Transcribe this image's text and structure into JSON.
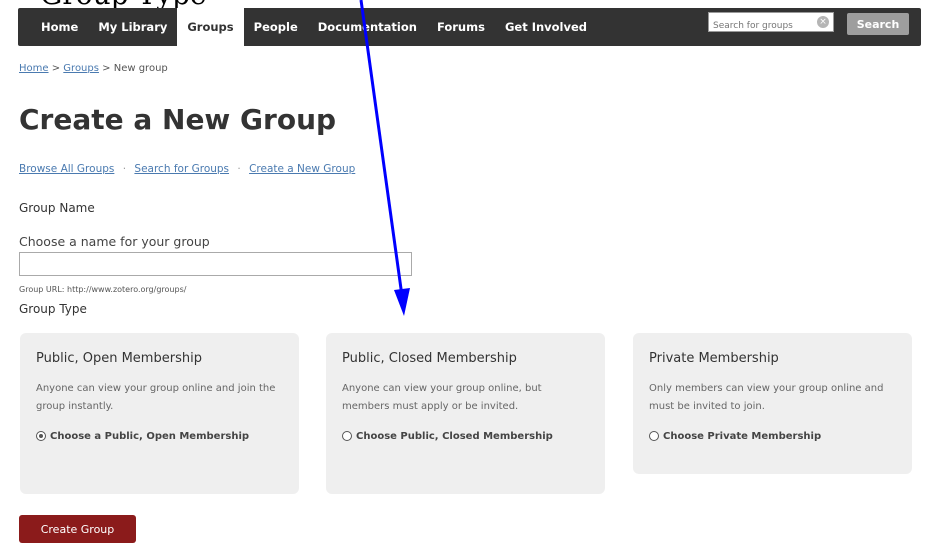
{
  "caption": "Group Type",
  "nav": {
    "items": [
      {
        "label": "Home"
      },
      {
        "label": "My Library"
      },
      {
        "label": "Groups"
      },
      {
        "label": "People"
      },
      {
        "label": "Documentation"
      },
      {
        "label": "Forums"
      },
      {
        "label": "Get Involved"
      }
    ],
    "active_item": "Groups",
    "search_placeholder": "Search for groups",
    "search_button": "Search"
  },
  "breadcrumb": {
    "home": "Home",
    "sep1": ">",
    "groups": "Groups",
    "sep2": ">",
    "current": "New group"
  },
  "page_title": "Create a New Group",
  "subnav": {
    "browse": "Browse All Groups",
    "search": "Search for Groups",
    "create": "Create a New Group",
    "sep": "·"
  },
  "form": {
    "group_name_label": "Group Name",
    "name_prompt": "Choose a name for your group",
    "name_value": "",
    "group_url": "Group URL: http://www.zotero.org/groups/",
    "group_type_label": "Group Type"
  },
  "group_types": [
    {
      "title": "Public, Open Membership",
      "description": "Anyone can view your group online and join the group instantly.",
      "option_label": "Choose a Public, Open Membership",
      "selected": true
    },
    {
      "title": "Public, Closed Membership",
      "description": "Anyone can view your group online, but members must apply or be invited.",
      "option_label": "Choose Public, Closed Membership",
      "selected": false
    },
    {
      "title": "Private Membership",
      "description": "Only members can view your group online and must be invited to join.",
      "option_label": "Choose Private Membership",
      "selected": false
    }
  ],
  "create_button": "Create Group",
  "colors": {
    "navbar": "#333333",
    "link": "#4a7ab0",
    "card_bg": "#efefef",
    "create_button": "#8b1b1b",
    "arrow": "#0000ff"
  }
}
